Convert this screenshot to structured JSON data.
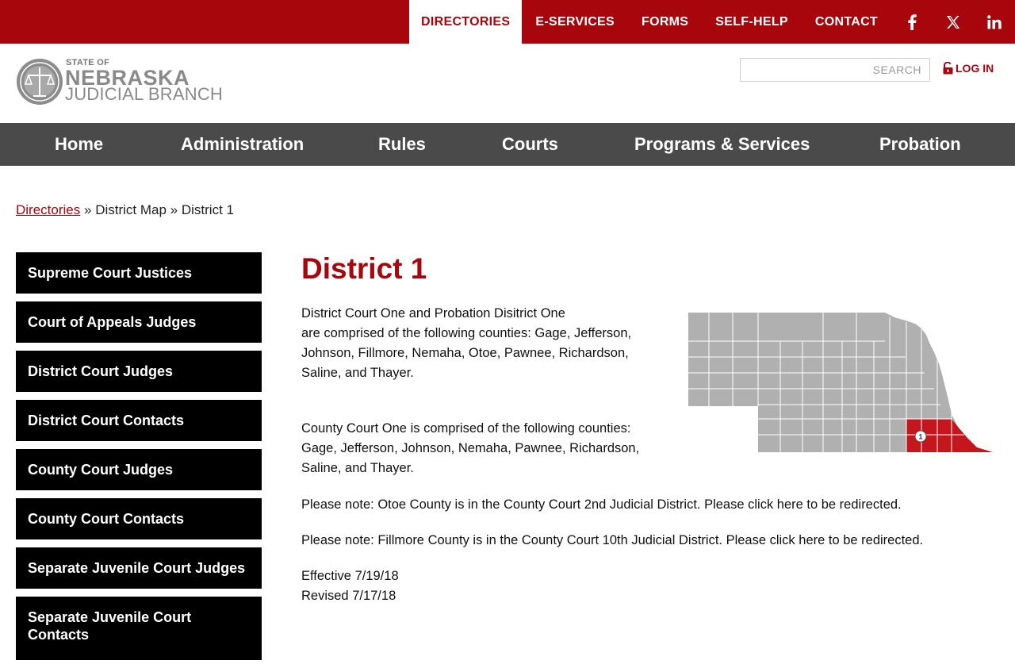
{
  "topnav": {
    "items": [
      "DIRECTORIES",
      "E-SERVICES",
      "FORMS",
      "SELF-HELP",
      "CONTACT"
    ],
    "active": "DIRECTORIES",
    "social": [
      "facebook-icon",
      "x-icon",
      "linkedin-icon"
    ]
  },
  "logo": {
    "state_of": "STATE OF",
    "name": "NEBRASKA",
    "branch": "JUDICIAL BRANCH"
  },
  "search": {
    "placeholder": "SEARCH",
    "value": ""
  },
  "login": {
    "label": "LOG IN",
    "icon": "lock-icon"
  },
  "mainnav": {
    "items": [
      "Home",
      "Administration",
      "Rules",
      "Courts",
      "Programs & Services",
      "Probation"
    ]
  },
  "breadcrumb": {
    "link": "Directories",
    "sep": "»",
    "middle": "District Map",
    "current": "District 1"
  },
  "sidebar": {
    "items": [
      "Supreme Court Justices",
      "Court of Appeals Judges",
      "District Court Judges",
      "District Court Contacts",
      "County Court Judges",
      "County Court Contacts",
      "Separate Juvenile Court Judges",
      "Separate Juvenile Court Contacts"
    ]
  },
  "content": {
    "title": "District 1",
    "p1_line1": "District Court One and Probation Disitrict One",
    "p1_rest": "are comprised of the following counties: Gage, Jefferson, Johnson, Fillmore, Nemaha, Otoe, Pawnee,  Richardson, Saline, and Thayer.",
    "p2": "County Court One is comprised of the following counties: Gage, Jefferson, Johnson, Nemaha, Pawnee, Richardson, Saline, and Thayer.",
    "p3": "Please note: Otoe County is in the County Court 2nd Judicial District. Please click here to be redirected.",
    "p4": "Please note: Fillmore County is in the County Court 10th Judicial District. Please click here to be redirected.",
    "effective": "Effective 7/19/18",
    "revised": "Revised 7/17/18"
  },
  "map": {
    "district_label": "1",
    "colors": {
      "state": "#b0b0b0",
      "highlight": "#c4161c",
      "border": "#ffffff"
    }
  },
  "colors": {
    "brand_red": "#a6060c",
    "nav_gray": "#4a4a4a",
    "sidebar_black": "#000000"
  }
}
